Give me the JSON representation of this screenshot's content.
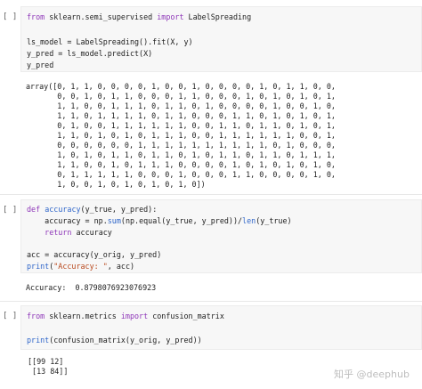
{
  "cells": [
    {
      "prompt": "[ ]",
      "code": [
        [
          {
            "t": "from",
            "c": "kw"
          },
          {
            "t": " sklearn.semi_supervised "
          },
          {
            "t": "import",
            "c": "kw"
          },
          {
            "t": " LabelSpreading"
          }
        ],
        [],
        [
          {
            "t": "ls_model = LabelSpreading().fit(X, y)"
          }
        ],
        [
          {
            "t": "y_pred = ls_model.predict(X)"
          }
        ],
        [
          {
            "t": "y_pred"
          }
        ]
      ],
      "output": [
        "array([0, 1, 1, 0, 0, 0, 0, 1, 0, 0, 1, 0, 0, 0, 0, 1, 0, 1, 1, 0, 0,",
        "       0, 0, 1, 0, 1, 1, 0, 0, 0, 1, 1, 0, 0, 0, 1, 0, 1, 0, 1, 0, 1,",
        "       1, 1, 0, 0, 1, 1, 1, 0, 1, 1, 0, 1, 0, 0, 0, 0, 1, 0, 0, 1, 0,",
        "       1, 1, 0, 1, 1, 1, 1, 0, 1, 1, 0, 0, 0, 1, 1, 0, 1, 0, 1, 0, 1,",
        "       0, 1, 0, 0, 1, 1, 1, 1, 1, 1, 0, 0, 1, 1, 0, 1, 1, 0, 1, 0, 1,",
        "       1, 1, 0, 1, 0, 1, 0, 1, 1, 1, 0, 0, 1, 1, 1, 1, 1, 1, 0, 0, 1,",
        "       0, 0, 0, 0, 0, 0, 1, 1, 1, 1, 1, 1, 1, 1, 1, 1, 0, 1, 0, 0, 0,",
        "       1, 0, 1, 0, 1, 1, 0, 1, 1, 0, 1, 0, 1, 1, 0, 1, 1, 0, 1, 1, 1,",
        "       1, 1, 0, 0, 1, 0, 1, 1, 1, 0, 0, 0, 0, 1, 0, 1, 0, 1, 0, 1, 0,",
        "       0, 1, 1, 1, 1, 1, 0, 0, 0, 1, 0, 0, 0, 1, 1, 0, 0, 0, 0, 1, 0,",
        "       1, 0, 0, 1, 0, 1, 0, 1, 0, 1, 0])"
      ]
    },
    {
      "prompt": "[ ]",
      "code": [
        [
          {
            "t": "def",
            "c": "kw"
          },
          {
            "t": " "
          },
          {
            "t": "accuracy",
            "c": "fn"
          },
          {
            "t": "(y_true, y_pred):"
          }
        ],
        [
          {
            "t": "    accuracy = np."
          },
          {
            "t": "sum",
            "c": "fn"
          },
          {
            "t": "(np.equal(y_true, y_pred))/"
          },
          {
            "t": "len",
            "c": "fn"
          },
          {
            "t": "(y_true)"
          }
        ],
        [
          {
            "t": "    "
          },
          {
            "t": "return",
            "c": "kw"
          },
          {
            "t": " accuracy"
          }
        ],
        [],
        [
          {
            "t": "acc = accuracy(y_orig, y_pred)"
          }
        ],
        [
          {
            "t": "print",
            "c": "fn"
          },
          {
            "t": "("
          },
          {
            "t": "\"Accuracy: \"",
            "c": "st"
          },
          {
            "t": ", acc)"
          }
        ]
      ],
      "output": [
        "Accuracy:  0.8798076923076923"
      ]
    },
    {
      "prompt": "[ ]",
      "code": [
        [
          {
            "t": "from",
            "c": "kw"
          },
          {
            "t": " sklearn.metrics "
          },
          {
            "t": "import",
            "c": "kw"
          },
          {
            "t": " confusion_matrix"
          }
        ],
        [],
        [
          {
            "t": "print",
            "c": "fn"
          },
          {
            "t": "(confusion_matrix(y_orig, y_pred))"
          }
        ]
      ],
      "output": [
        "[[99 12]",
        " [13 84]]"
      ]
    }
  ],
  "watermark": "知乎 @deephub",
  "colors": {
    "keyword": "#8e36b8",
    "function": "#2e65c9",
    "string": "#b8471b",
    "code_bg": "#f7f7f7"
  }
}
